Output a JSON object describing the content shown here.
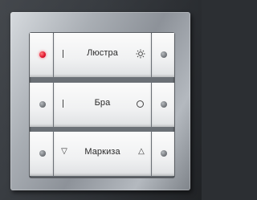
{
  "panel": {
    "rows": [
      {
        "label": "Люстра",
        "left_symbol_icon": "bar-icon",
        "right_symbol_icon": "sun-icon",
        "left_led": "red-led",
        "right_led": "gray-led"
      },
      {
        "label": "Бра",
        "left_symbol_icon": "bar-icon",
        "right_symbol_icon": "circle-icon",
        "left_led": "gray-led",
        "right_led": "gray-led"
      },
      {
        "label": "Маркиза",
        "left_symbol_icon": "triangle-down-icon",
        "right_symbol_icon": "triangle-up-icon",
        "left_symbol": "▽",
        "right_symbol": "△",
        "left_led": "gray-led",
        "right_led": "gray-led"
      }
    ],
    "colors": {
      "led_active": "#e0112b",
      "led_inactive": "#6a6e73",
      "rocker_face": "#f0f1f2",
      "frame": "#a9aeb4"
    }
  }
}
